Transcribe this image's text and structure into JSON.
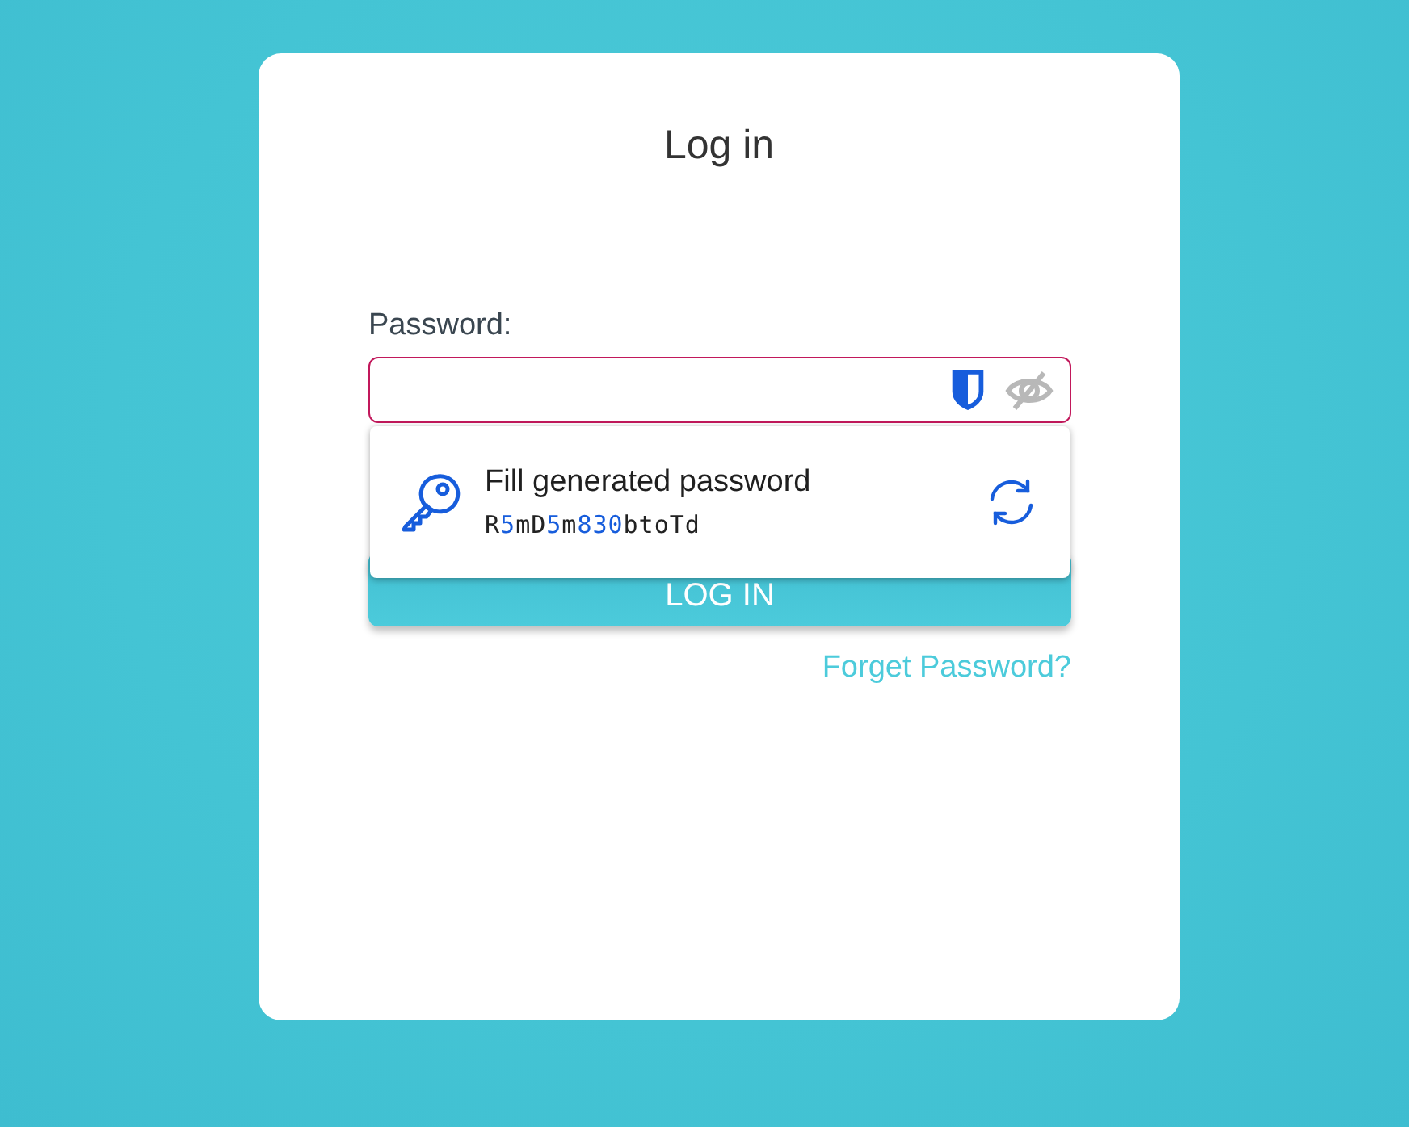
{
  "card": {
    "title": "Log in"
  },
  "password_field": {
    "label": "Password:",
    "focused": true
  },
  "autofill_popup": {
    "title": "Fill generated password",
    "password": [
      {
        "text": "R",
        "kind": "letter"
      },
      {
        "text": "5",
        "kind": "digit"
      },
      {
        "text": "mD",
        "kind": "letter"
      },
      {
        "text": "5",
        "kind": "digit"
      },
      {
        "text": "m",
        "kind": "letter"
      },
      {
        "text": "830",
        "kind": "digit"
      },
      {
        "text": "btoTd",
        "kind": "letter"
      }
    ]
  },
  "login_button": {
    "label": "LOG IN"
  },
  "forgot_link": {
    "label": "Forget Password?"
  }
}
